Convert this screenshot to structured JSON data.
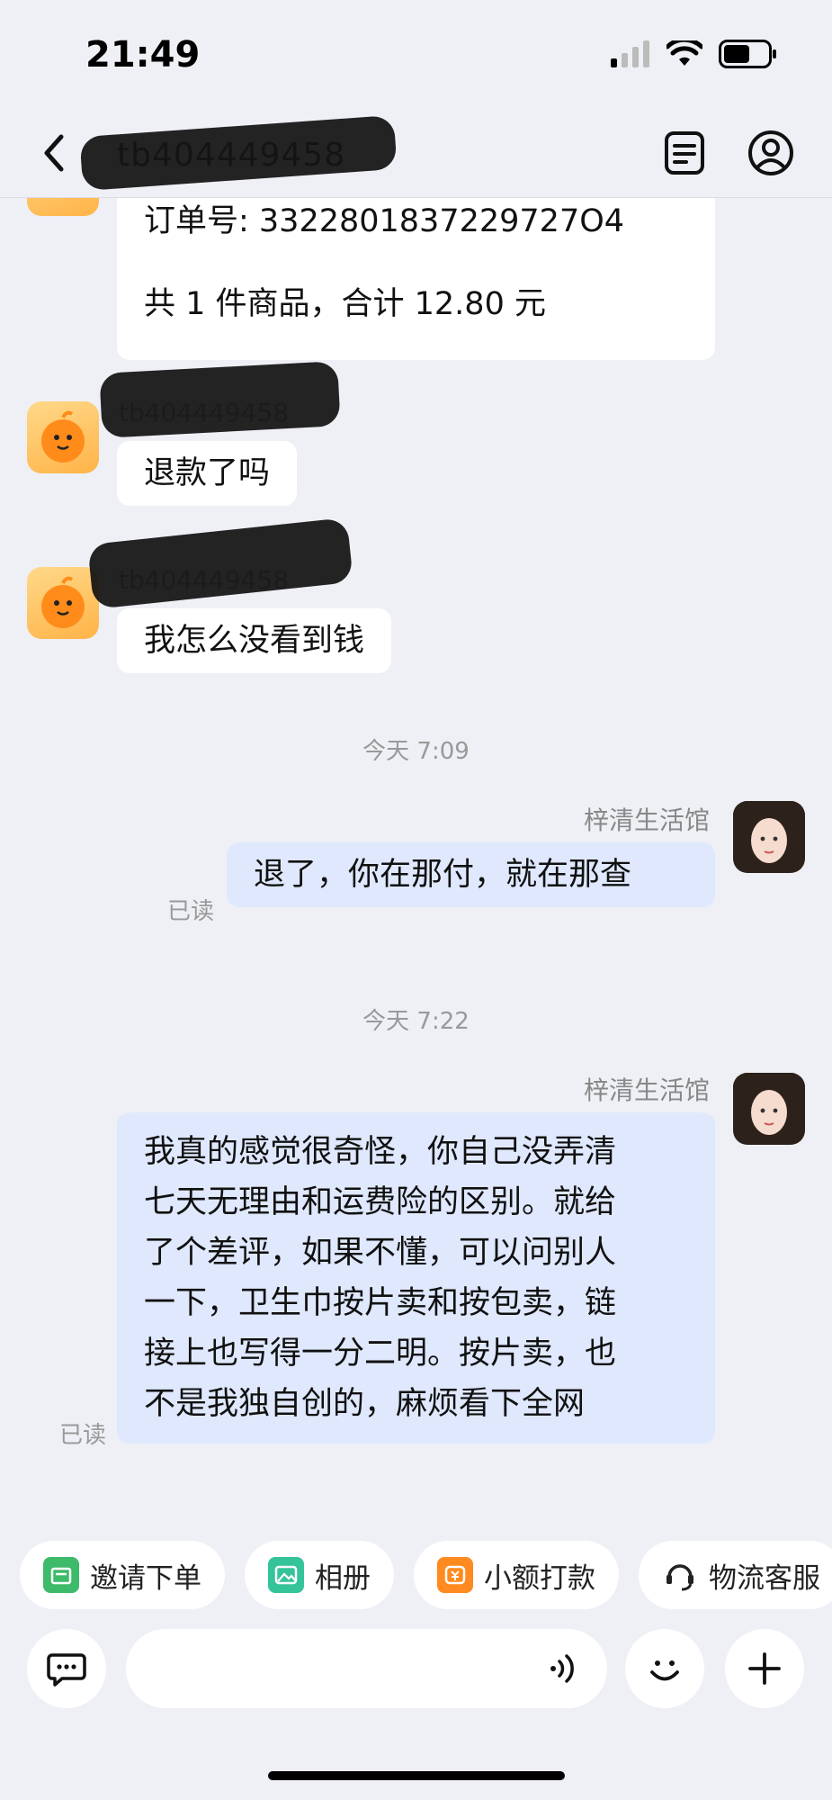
{
  "status_bar": {
    "time": "21:49",
    "battery_level": 0.55
  },
  "header": {
    "title": "tb404449458"
  },
  "messages": {
    "order": {
      "order_no": "订单号: 3322801837229727O4",
      "summary": "共 1 件商品，合计 12.80 元"
    },
    "m1": {
      "sender": "tb404449458",
      "text": "退款了吗"
    },
    "m2": {
      "sender": "tb404449458",
      "text": "我怎么没看到钱"
    },
    "sep1": "今天 7:09",
    "m3": {
      "sender": "梓清生活馆",
      "text": "退了，你在那付，就在那查",
      "read": "已读"
    },
    "sep2": "今天 7:22",
    "m4": {
      "sender": "梓清生活馆",
      "lines": [
        "我真的感觉很奇怪，你自己没弄清",
        "七天无理由和运费险的区别。就给",
        "了个差评，如果不懂，可以问别人",
        "一下，卫生巾按片卖和按包卖，链",
        "接上也写得一分二明。按片卖，也",
        "不是我独自创的，麻烦看下全网"
      ],
      "read": "已读"
    }
  },
  "quick_actions": [
    {
      "label": "邀请下单",
      "icon": "invite-order-icon",
      "color": "#3dbb6b"
    },
    {
      "label": "相册",
      "icon": "album-icon",
      "color": "#35c39a"
    },
    {
      "label": "小额打款",
      "icon": "small-payment-icon",
      "color": "#ff8a1f"
    },
    {
      "label": "物流客服",
      "icon": "logistics-service-icon",
      "color": "#222222"
    }
  ],
  "input": {
    "placeholder": ""
  }
}
